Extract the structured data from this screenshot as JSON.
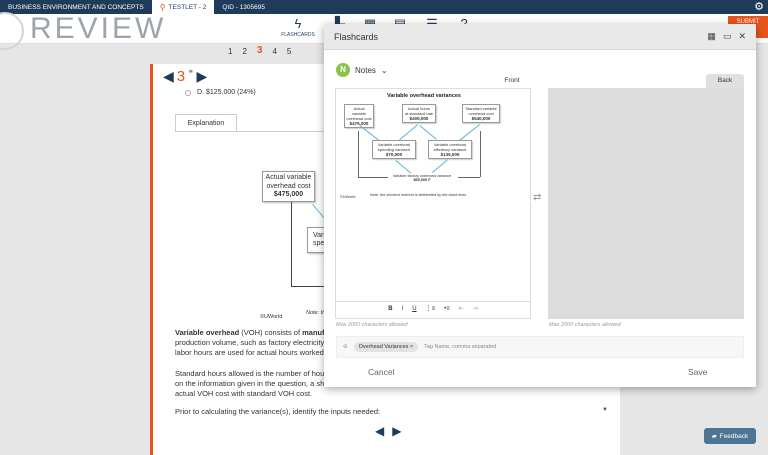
{
  "topbar": {
    "section": "BUSINESS ENVIRONMENT AND CONCEPTS",
    "testlet": "TESTLET - 2",
    "qid": "QID - 1305695"
  },
  "header": {
    "logo": "REVIEW",
    "flashcards_label": "FLASHCARDS",
    "submit_label": "SUBMIT",
    "submit_sub": "T"
  },
  "pager": [
    "1",
    "2",
    "3",
    "4",
    "5"
  ],
  "question": {
    "number": "3",
    "answer_text": "D. $125,000  (24%)",
    "explanation_tab": "Explanation",
    "box1": [
      "Actual variable",
      "overhead cost",
      "$475,000"
    ],
    "box2": [
      "Varia",
      "spen"
    ],
    "copyright": "©UWorld",
    "note_stub": "Note: tl",
    "para1_bold1": "Variable overhead",
    "para1_text1": " (VOH) consists of ",
    "para1_bold2": "manufa",
    "para1_line2": "production volume, such as factory electricity",
    "para1_line3": "labor hours are used for actual hours worked",
    "para2_line1": "Standard hours allowed is the number of hour",
    "para2_line2": "on the information given in the question, a sh",
    "para2_line3": "actual VOH cost with standard VOH cost.",
    "para3": "Prior to calculating the variance(s), identify the inputs needed:"
  },
  "flashcards": {
    "title": "Flashcards",
    "notes_badge": "N",
    "notes_label": "Notes",
    "front_label": "Front",
    "back_label": "Back",
    "max_chars": "Max 2000 characters allowed",
    "tag_chip": "Overhead Variances",
    "tag_placeholder": "Tag Name, comma separated",
    "cancel": "Cancel",
    "save": "Save",
    "diagram": {
      "title": "Variable overhead variances",
      "b1": [
        "Actual variable",
        "overhead cost",
        "$475,000"
      ],
      "b2": [
        "Actual hours",
        "at standard rate",
        "$405,000"
      ],
      "b3": [
        "Standard variable",
        "overhead cost",
        "$540,000"
      ],
      "b4": [
        "Variable overhead",
        "spending variance",
        "$70,000"
      ],
      "b5": [
        "Variable overhead",
        "efficiency variance",
        "$135,000"
      ],
      "total": [
        "Variable factory overhead variance",
        "$65,000 F"
      ],
      "copyright": "©UWorld",
      "note": "Note: the shortcut method is delineated by the black lines"
    }
  },
  "feedback_label": "Feedback"
}
